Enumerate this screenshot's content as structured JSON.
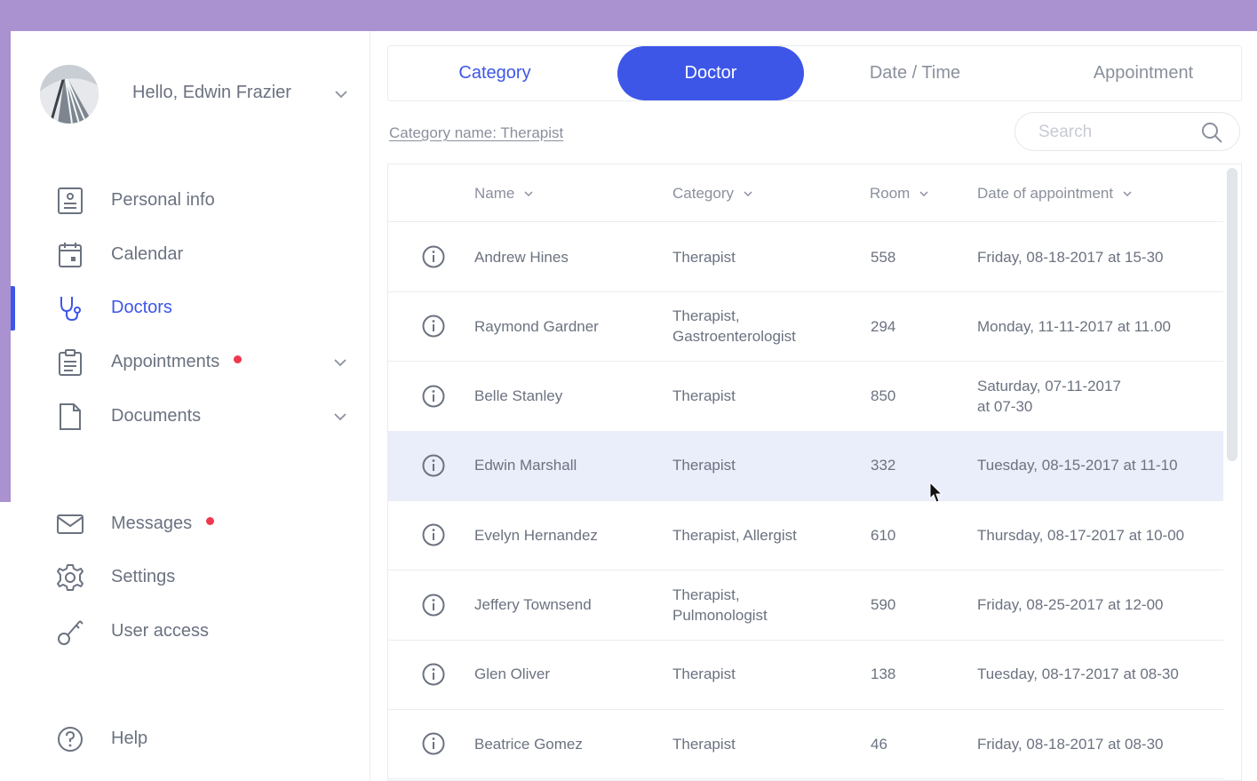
{
  "colors": {
    "accent": "#3d56e8",
    "background_purple": "#a992cf",
    "notification_dot": "#f0384f",
    "highlight_row": "#eaedfa"
  },
  "profile": {
    "greeting": "Hello, Edwin Frazier"
  },
  "sidebar": {
    "items": [
      {
        "label": "Personal info",
        "icon": "id-card-icon"
      },
      {
        "label": "Calendar",
        "icon": "calendar-icon"
      },
      {
        "label": "Doctors",
        "icon": "stethoscope-icon",
        "active": true
      },
      {
        "label": "Appointments",
        "icon": "clipboard-icon",
        "badge": true,
        "expandable": true
      },
      {
        "label": "Documents",
        "icon": "document-icon",
        "expandable": true
      },
      {
        "label": "Messages",
        "icon": "envelope-icon",
        "badge": true
      },
      {
        "label": "Settings",
        "icon": "gear-icon"
      },
      {
        "label": "User access",
        "icon": "key-icon"
      },
      {
        "label": "Help",
        "icon": "help-icon"
      }
    ]
  },
  "tabs": [
    {
      "label": "Category"
    },
    {
      "label": "Doctor",
      "active": true
    },
    {
      "label": "Date / Time"
    },
    {
      "label": "Appointment"
    }
  ],
  "filter": {
    "category_name": "Category name: Therapist"
  },
  "search": {
    "placeholder": "Search"
  },
  "table": {
    "columns": [
      "Name",
      "Category",
      "Room",
      "Date of appointment"
    ],
    "rows": [
      {
        "name": "Andrew Hines",
        "category": [
          "Therapist"
        ],
        "room": "558",
        "date": [
          "Friday, 08-18-2017 at 15-30"
        ]
      },
      {
        "name": "Raymond Gardner",
        "category": [
          "Therapist,",
          "Gastroenterologist"
        ],
        "room": "294",
        "date": [
          "Monday, 11-11-2017 at 11.00"
        ]
      },
      {
        "name": "Belle Stanley",
        "category": [
          "Therapist"
        ],
        "room": "850",
        "date": [
          "Saturday, 07-11-2017",
          "at 07-30"
        ]
      },
      {
        "name": "Edwin Marshall",
        "category": [
          "Therapist"
        ],
        "room": "332",
        "date": [
          "Tuesday, 08-15-2017 at 11-10"
        ],
        "highlighted": true
      },
      {
        "name": "Evelyn Hernandez",
        "category": [
          "Therapist, Allergist"
        ],
        "room": "610",
        "date": [
          "Thursday, 08-17-2017 at 10-00"
        ]
      },
      {
        "name": "Jeffery Townsend",
        "category": [
          "Therapist,",
          "Pulmonologist"
        ],
        "room": "590",
        "date": [
          "Friday, 08-25-2017 at 12-00"
        ]
      },
      {
        "name": "Glen Oliver",
        "category": [
          "Therapist"
        ],
        "room": "138",
        "date": [
          "Tuesday, 08-17-2017 at 08-30"
        ]
      },
      {
        "name": "Beatrice Gomez",
        "category": [
          "Therapist"
        ],
        "room": "46",
        "date": [
          "Friday, 08-18-2017 at 08-30"
        ]
      }
    ]
  }
}
